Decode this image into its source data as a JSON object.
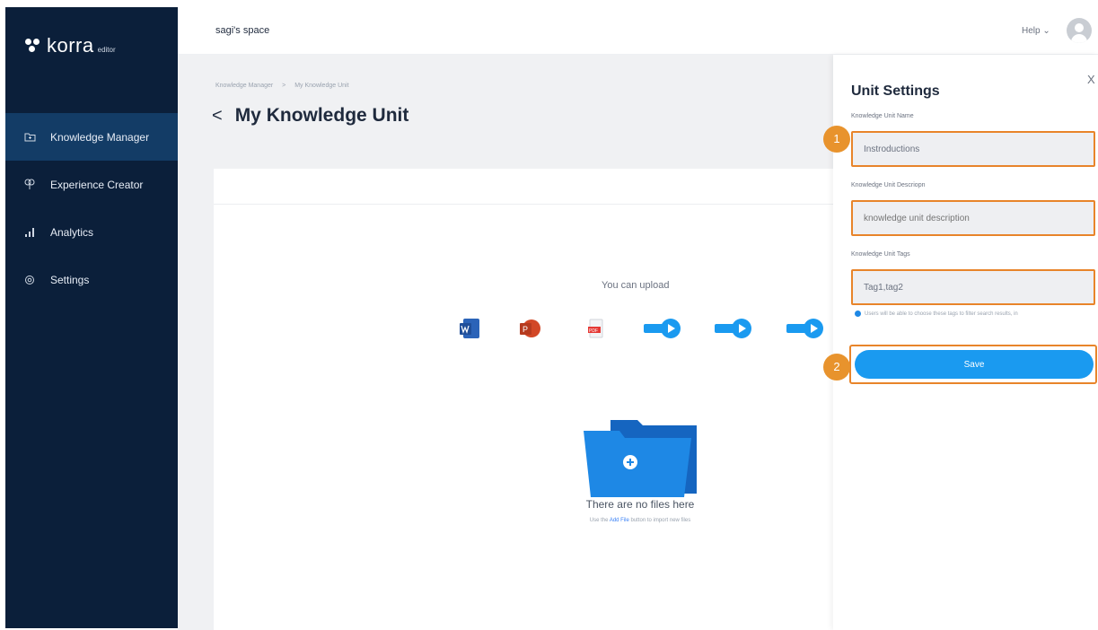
{
  "sidebar": {
    "logo_text": "korra",
    "logo_sub": "editor",
    "items": [
      {
        "label": "Knowledge Manager",
        "icon": "folder-icon",
        "active": true
      },
      {
        "label": "Experience Creator",
        "icon": "bulb-icon",
        "active": false
      },
      {
        "label": "Analytics",
        "icon": "bar-chart-icon",
        "active": false
      },
      {
        "label": "Settings",
        "icon": "gear-icon",
        "active": false
      }
    ]
  },
  "topbar": {
    "space": "sagi's space",
    "help": "Help ⌄",
    "avatar_icon": "user-avatar-icon"
  },
  "main": {
    "breadcrumb": [
      "Knowledge Manager",
      ">",
      "My Knowledge Unit"
    ],
    "back_icon": "<",
    "title": "My Knowledge Unit",
    "upload_label": "You can upload",
    "file_types": [
      "word-icon",
      "powerpoint-icon",
      "pdf-icon",
      "mp4-icon",
      "mov-icon",
      "webm-icon"
    ],
    "empty_title": "There are no files here",
    "hint_before": "Use the ",
    "hint_link": "Add File",
    "hint_after": " button to import new files"
  },
  "panel": {
    "close": "X",
    "title": "Unit Settings",
    "name_label": "Knowledge Unit Name",
    "name_value": "Instroductions",
    "desc_label": "Knowledge Unit Descriopn",
    "desc_placeholder": "knowledge unit description",
    "tags_label": "Knowledge Unit Tags",
    "tags_value": "Tag1,tag2",
    "note": "Users will be able to choose these tags to filter search results, in",
    "save_label": "Save",
    "badge1": "1",
    "badge2": "2"
  },
  "colors": {
    "sidebar_bg": "#0b1f3a",
    "sidebar_active": "#133c66",
    "accent": "#1a9af0",
    "highlight": "#e8842a",
    "badge": "#e8932d"
  }
}
